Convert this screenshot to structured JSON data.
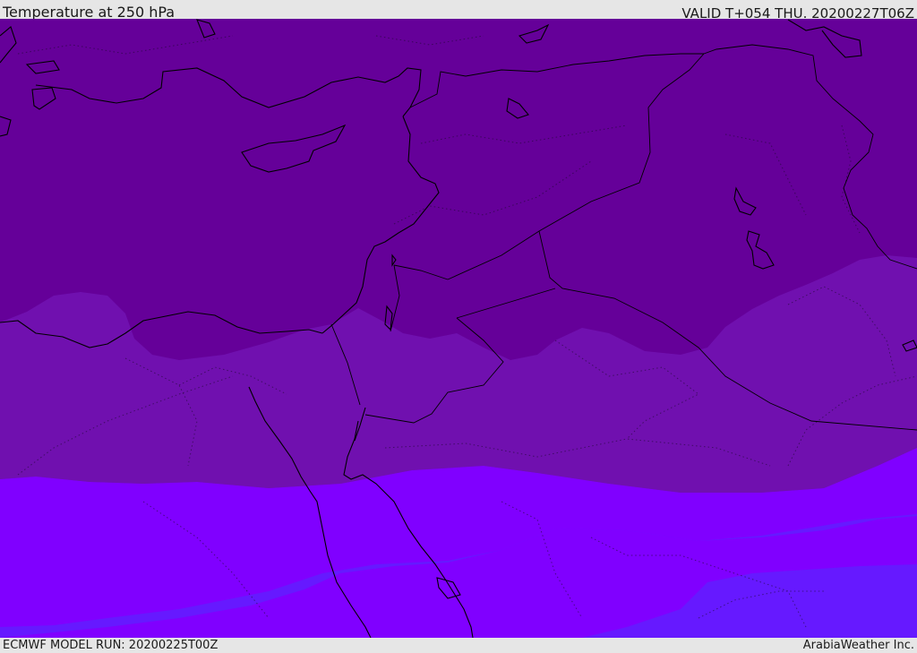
{
  "header": {
    "title": "Temperature at 250 hPa",
    "valid": "VALID T+054 THU. 20200227T06Z"
  },
  "footer": {
    "model_run": "ECMWF MODEL RUN: 20200225T00Z",
    "credit": "ArabiaWeather Inc."
  },
  "map": {
    "field": "temperature",
    "level": "250 hPa",
    "colors": {
      "band_coldest": "#650099",
      "band_2": "#7010af",
      "band_3": "#7d00d9",
      "band_4": "#8000ff",
      "band_warmest": "#6619ff",
      "coastline": "#000000",
      "borders": "#000000"
    }
  }
}
